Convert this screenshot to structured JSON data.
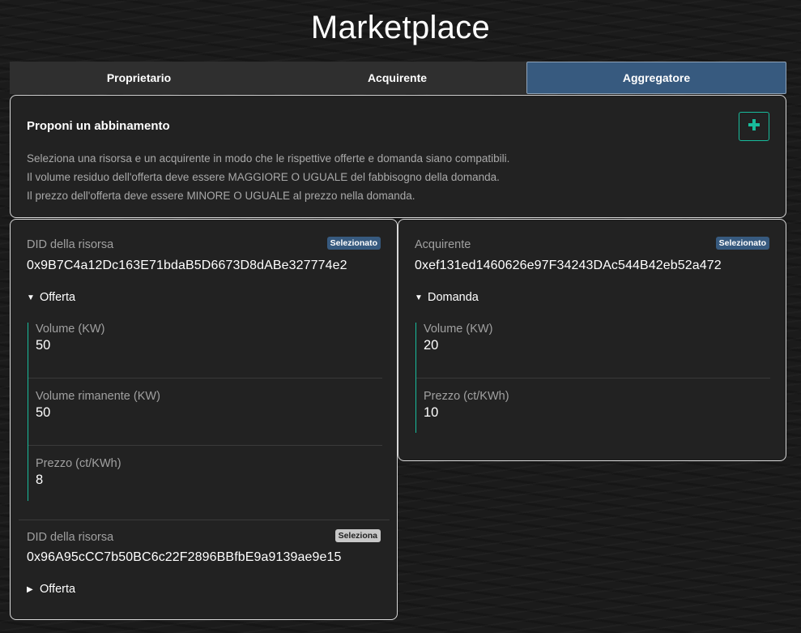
{
  "page": {
    "title": "Marketplace"
  },
  "tabs": [
    {
      "label": "Proprietario",
      "active": false
    },
    {
      "label": "Acquirente",
      "active": false
    },
    {
      "label": "Aggregatore",
      "active": true
    }
  ],
  "propose": {
    "heading": "Proponi un abbinamento",
    "add_icon": "plus-icon",
    "lines": [
      "Seleziona una risorsa e un acquirente in modo che le rispettive offerte e domanda siano compatibili.",
      "Il volume residuo dell'offerta deve essere MAGGIORE O UGUALE del fabbisogno della domanda.",
      "Il prezzo dell'offerta deve essere MINORE O UGUALE al prezzo nella domanda."
    ]
  },
  "resources": [
    {
      "label": "DID della risorsa",
      "badge": "Selezionato",
      "address": "0x9B7C4a12Dc163E71bdaB5D6673D8dABe327774e2",
      "toggle_label": "Offerta",
      "expanded": true,
      "details": [
        {
          "label": "Volume (KW)",
          "value": "50"
        },
        {
          "label": "Volume rimanente (KW)",
          "value": "50"
        },
        {
          "label": "Prezzo (ct/KWh)",
          "value": "8"
        }
      ]
    },
    {
      "label": "DID della risorsa",
      "badge": "Seleziona",
      "address": "0x96A95cCC7b50BC6c22F2896BBfbE9a9139ae9e15",
      "toggle_label": "Offerta",
      "expanded": false
    }
  ],
  "buyer": {
    "label": "Acquirente",
    "badge": "Selezionato",
    "address": "0xef131ed1460626e97F34243DAc544B42eb52a472",
    "toggle_label": "Domanda",
    "expanded": true,
    "details": [
      {
        "label": "Volume (KW)",
        "value": "20"
      },
      {
        "label": "Prezzo (ct/KWh)",
        "value": "10"
      }
    ]
  },
  "colors": {
    "accent": "#18bc9c",
    "selected_badge": "#375a7f",
    "active_tab": "#375a7f"
  }
}
